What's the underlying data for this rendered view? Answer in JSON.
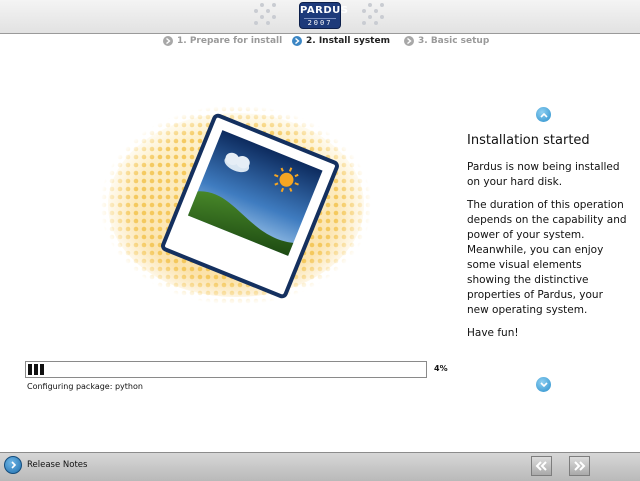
{
  "header": {
    "logo": {
      "name": "PARDUS",
      "year": "2007"
    }
  },
  "steps": [
    {
      "label": "1. Prepare for install",
      "state": "done"
    },
    {
      "label": "2. Install system",
      "state": "active"
    },
    {
      "label": "3. Basic setup",
      "state": "pending"
    }
  ],
  "info": {
    "title": "Installation started",
    "paragraphs": [
      "Pardus is now being installed on your hard disk.",
      "The duration of this operation depends on the capability and power of your system. Meanwhile, you can enjoy some visual elements showing the distinctive properties of Pardus, your new operating system.",
      "Have fun!"
    ]
  },
  "progress": {
    "value": 0.04,
    "percent_label": "4%",
    "status_text": "Configuring package: python"
  },
  "footer": {
    "release_notes_label": "Release Notes"
  },
  "colors": {
    "accent": "#3c86c4",
    "header_bg": "#e8e8e8",
    "footer_bg": "#c8c8c8",
    "logo_bg": "#1d3a7a"
  },
  "icons": {
    "scroll_up": "chevron-up-icon",
    "scroll_down": "chevron-down-icon",
    "release_notes": "chevron-right-icon",
    "back": "double-chevron-left-icon",
    "next": "double-chevron-right-icon",
    "illustration": "photo-image-icon"
  }
}
